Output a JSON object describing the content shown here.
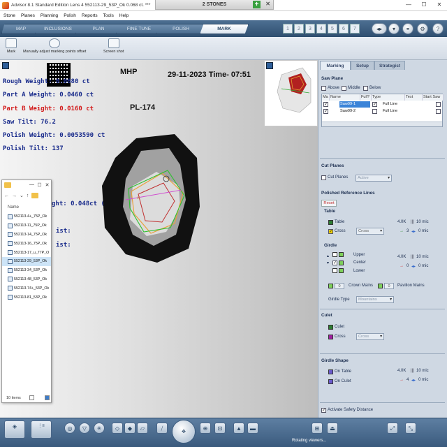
{
  "titlebar": {
    "title": "Advisor 8.1 Standard Edition Lens 4   552113-29_53P_Ok   0.068 ct. ***",
    "stones_tab": "2 STONES",
    "plus_label": "+",
    "tab_close": "✕",
    "min_label": "—",
    "max_label": "☐",
    "close_label": "✕"
  },
  "menu": [
    "Stone",
    "Planes",
    "Planning",
    "Polish",
    "Reports",
    "Tools",
    "Help"
  ],
  "main_tabs": [
    {
      "label": "MAP",
      "active": false
    },
    {
      "label": "INCLUSIONS",
      "active": false
    },
    {
      "label": "PLAN",
      "active": false
    },
    {
      "label": "FINE TUNE",
      "active": false
    },
    {
      "label": "POLISH",
      "active": false
    },
    {
      "label": "MARK",
      "active": true
    }
  ],
  "stone_numbers": [
    "1",
    "2",
    "3",
    "4",
    "5",
    "6",
    "7"
  ],
  "toolbar": {
    "mark_label": "Mark",
    "manual_label": "Manually adjust marking points offset",
    "screenshot_label": "Screen shot"
  },
  "view": {
    "header_left": "MHP",
    "header_date": "29-11-2023 Time- 07:51",
    "stone_id": "PL-174",
    "rough_weight": "Rough Weight: 0.0680 ct",
    "part_a_weight": "Part A Weight: 0.0460 ct",
    "part_b_weight": "Part B Weight: 0.0160 ct",
    "saw_tilt": "Saw Tilt: 76.2",
    "polish_weight": "Polish Weight: 0.0053590 ct",
    "polish_tilt": "Polish Tilt: 137",
    "partial_weight": "ght: 0.048ct (70.6%",
    "partial_ist_1": "ist:",
    "partial_ist_2": "ist:"
  },
  "explorer": {
    "minimize": "—",
    "maximize": "☐",
    "close": "✕",
    "nav_back": "←",
    "nav_forward": "→",
    "nav_dropdown": "⌄",
    "nav_up": "↑",
    "column_header": "Name",
    "files": [
      {
        "name": "552113-4+_75P_Ok",
        "selected": false
      },
      {
        "name": "552113-11_75P_Ok",
        "selected": false
      },
      {
        "name": "552113-14_75P_Ok",
        "selected": false
      },
      {
        "name": "552113-16_75P_Ok",
        "selected": false
      },
      {
        "name": "552113-17_u_77P_O",
        "selected": false
      },
      {
        "name": "552113-29_53P_Ok",
        "selected": true
      },
      {
        "name": "552113-34_53P_Ok",
        "selected": false
      },
      {
        "name": "552113-48_53P_Ok",
        "selected": false
      },
      {
        "name": "552113-74+_53P_Ok",
        "selected": false
      },
      {
        "name": "552113-81_53P_Ok",
        "selected": false
      }
    ],
    "status": "10 items"
  },
  "panel": {
    "tabs": [
      "Marking",
      "Setup",
      "Strategist"
    ],
    "saw_plane": {
      "title": "Saw Plane",
      "above": "Above",
      "middle": "Middle",
      "below": "Below",
      "columns": [
        "Ma",
        "Name",
        "Full?",
        "Type",
        "Text",
        "Start Saw"
      ],
      "rows": [
        {
          "name": "Saw99-1",
          "full": true,
          "type": "Full Line",
          "checked": true
        },
        {
          "name": "Saw99-2",
          "full": false,
          "type": "Full Line",
          "checked": true
        }
      ]
    },
    "cut_planes": {
      "title": "Cut Planes",
      "checkbox": "Cut Planes",
      "select": "Active"
    },
    "polished_ref": {
      "title": "Polished Reference Lines",
      "reset": "Reset",
      "table_title": "Table",
      "table_label": "Table",
      "cross_label": "Cross",
      "cross_select": "Cross",
      "table_size": "4.0K",
      "table_mic": "10 mic",
      "cross_mic": "0 mic",
      "cross_num": "3",
      "girdle_title": "Girdle",
      "upper": "Upper",
      "center": "Center",
      "lower": "Lower",
      "girdle_size": "4.0K",
      "girdle_mic": "10 mic",
      "girdle_val": "0",
      "girdle_mic2": "0 mic",
      "spin_val": "0",
      "crown_mains": "Crown Mains",
      "pavilion_mains": "Pavilion Mains",
      "girdle_type_label": "Girdle Type",
      "girdle_type_value": "Mountains"
    },
    "culet": {
      "title": "Culet",
      "culet_label": "Culet",
      "cross_label": "Cross",
      "cross_select": "Cross"
    },
    "girdle_shape": {
      "title": "Girdle Shape",
      "on_table": "On Table",
      "on_culet": "On Culet",
      "table_size": "4.0K",
      "table_mic": "10 mic",
      "culet_val": "4",
      "culet_mic": "0 mic"
    },
    "safety_distance": "Activate Safety Distance"
  },
  "statusbar": {
    "text": "Rotating viewers..."
  },
  "colors": {
    "accent": "#3b84d8",
    "weight_blue": "#1a2c8c",
    "weight_red": "#d21919",
    "table_swatch": "#2e7d32",
    "cross_swatch": "#f1d100",
    "culet_swatch": "#2e7d32",
    "culet_cross_swatch": "#a020a0",
    "girdle_on_table": "#6a5acd",
    "girdle_on_culet": "#6a5acd"
  }
}
